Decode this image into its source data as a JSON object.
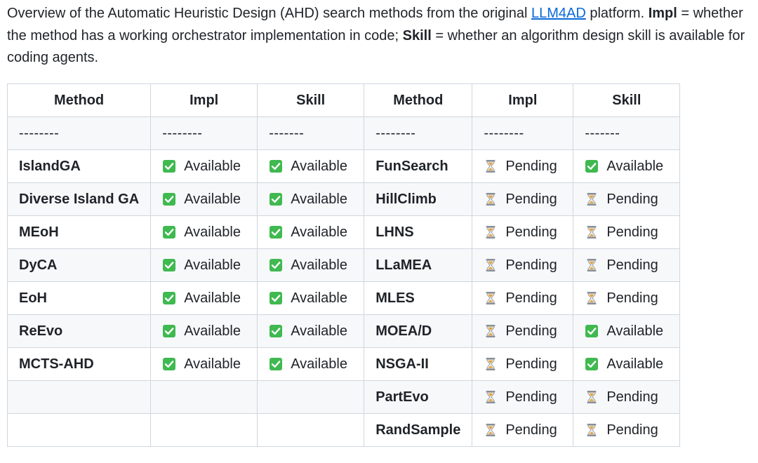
{
  "intro": {
    "prefix": "Overview of the Automatic Heuristic Design (AHD) search methods from the original ",
    "link_text": "LLM4AD",
    "after_link": " platform. ",
    "impl_term": "Impl",
    "impl_def": " = whether the method has a working orchestrator implementation in code; ",
    "skill_term": "Skill",
    "skill_def": " = whether an algorithm design skill is available for coding agents."
  },
  "table": {
    "headers": [
      "Method",
      "Impl",
      "Skill",
      "Method",
      "Impl",
      "Skill"
    ],
    "separators": [
      "--------",
      "--------",
      "-------",
      "--------",
      "--------",
      "-------"
    ],
    "rows": [
      [
        {
          "text": "IslandGA"
        },
        {
          "text": "Available",
          "icon": "check-icon"
        },
        {
          "text": "Available",
          "icon": "check-icon"
        },
        {
          "text": "FunSearch"
        },
        {
          "text": "Pending",
          "icon": "hourglass-icon"
        },
        {
          "text": "Available",
          "icon": "check-icon"
        }
      ],
      [
        {
          "text": "Diverse Island GA"
        },
        {
          "text": "Available",
          "icon": "check-icon"
        },
        {
          "text": "Available",
          "icon": "check-icon"
        },
        {
          "text": "HillClimb"
        },
        {
          "text": "Pending",
          "icon": "hourglass-icon"
        },
        {
          "text": "Pending",
          "icon": "hourglass-icon"
        }
      ],
      [
        {
          "text": "MEoH"
        },
        {
          "text": "Available",
          "icon": "check-icon"
        },
        {
          "text": "Available",
          "icon": "check-icon"
        },
        {
          "text": "LHNS"
        },
        {
          "text": "Pending",
          "icon": "hourglass-icon"
        },
        {
          "text": "Pending",
          "icon": "hourglass-icon"
        }
      ],
      [
        {
          "text": "DyCA"
        },
        {
          "text": "Available",
          "icon": "check-icon"
        },
        {
          "text": "Available",
          "icon": "check-icon"
        },
        {
          "text": "LLaMEA"
        },
        {
          "text": "Pending",
          "icon": "hourglass-icon"
        },
        {
          "text": "Pending",
          "icon": "hourglass-icon"
        }
      ],
      [
        {
          "text": "EoH"
        },
        {
          "text": "Available",
          "icon": "check-icon"
        },
        {
          "text": "Available",
          "icon": "check-icon"
        },
        {
          "text": "MLES"
        },
        {
          "text": "Pending",
          "icon": "hourglass-icon"
        },
        {
          "text": "Pending",
          "icon": "hourglass-icon"
        }
      ],
      [
        {
          "text": "ReEvo"
        },
        {
          "text": "Available",
          "icon": "check-icon"
        },
        {
          "text": "Available",
          "icon": "check-icon"
        },
        {
          "text": "MOEA/D"
        },
        {
          "text": "Pending",
          "icon": "hourglass-icon"
        },
        {
          "text": "Available",
          "icon": "check-icon"
        }
      ],
      [
        {
          "text": "MCTS-AHD"
        },
        {
          "text": "Available",
          "icon": "check-icon"
        },
        {
          "text": "Available",
          "icon": "check-icon"
        },
        {
          "text": "NSGA-II"
        },
        {
          "text": "Pending",
          "icon": "hourglass-icon"
        },
        {
          "text": "Available",
          "icon": "check-icon"
        }
      ],
      [
        {
          "text": ""
        },
        {
          "text": ""
        },
        {
          "text": ""
        },
        {
          "text": "PartEvo"
        },
        {
          "text": "Pending",
          "icon": "hourglass-icon"
        },
        {
          "text": "Pending",
          "icon": "hourglass-icon"
        }
      ],
      [
        {
          "text": ""
        },
        {
          "text": ""
        },
        {
          "text": ""
        },
        {
          "text": "RandSample"
        },
        {
          "text": "Pending",
          "icon": "hourglass-icon"
        },
        {
          "text": "Pending",
          "icon": "hourglass-icon"
        }
      ]
    ]
  },
  "colors": {
    "link": "#0969da",
    "check_bg": "#3fb950",
    "border": "#d0d7de",
    "stripe": "#f6f8fa",
    "hourglass_sand": "#e3a33a",
    "hourglass_frame": "#8a8f98"
  }
}
